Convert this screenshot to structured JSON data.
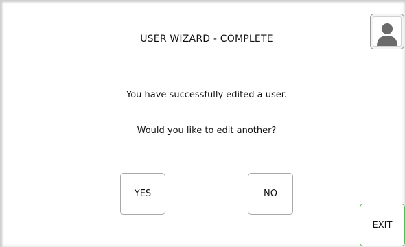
{
  "header": {
    "title": "USER WIZARD - COMPLETE"
  },
  "message": {
    "line1": "You have successfully edited a user.",
    "line2": "Would you like to edit another?"
  },
  "actions": {
    "yes_label": "YES",
    "no_label": "NO",
    "exit_label": "EXIT"
  },
  "icons": {
    "user": "user-icon"
  },
  "colors": {
    "exit_border": "#5cb85c",
    "user_icon": "#6b6b6b"
  }
}
